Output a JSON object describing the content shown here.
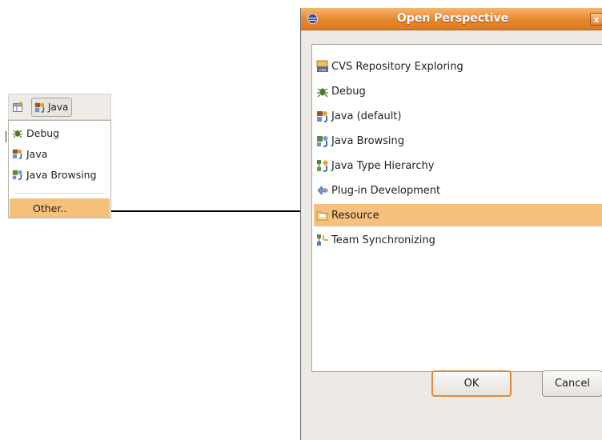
{
  "switcher": {
    "current_perspective": "Java",
    "menu_items": [
      {
        "label": "Debug",
        "icon": "debug-icon"
      },
      {
        "label": "Java",
        "icon": "java-icon"
      },
      {
        "label": "Java Browsing",
        "icon": "java-browsing-icon"
      }
    ],
    "other_label": "Other.."
  },
  "dialog": {
    "title": "Open Perspective",
    "close_glyph": "x",
    "perspectives": [
      {
        "label": "CVS Repository Exploring",
        "icon": "cvs-icon"
      },
      {
        "label": "Debug",
        "icon": "debug-icon"
      },
      {
        "label": "Java (default)",
        "icon": "java-icon"
      },
      {
        "label": "Java Browsing",
        "icon": "java-browsing-icon"
      },
      {
        "label": "Java Type Hierarchy",
        "icon": "type-hierarchy-icon"
      },
      {
        "label": "Plug-in Development",
        "icon": "plugin-icon"
      },
      {
        "label": "Resource",
        "icon": "resource-folder-icon",
        "selected": true
      },
      {
        "label": "Team Synchronizing",
        "icon": "team-sync-icon"
      }
    ],
    "ok_label": "OK",
    "cancel_label": "Cancel"
  },
  "colors": {
    "selection": "#f6c07f",
    "titlebar": "#e7872d",
    "default_button_border": "#e08a3a"
  }
}
